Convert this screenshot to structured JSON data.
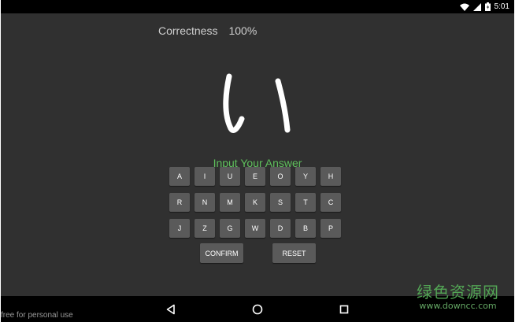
{
  "status_bar": {
    "time": "5:01",
    "icons": [
      "wifi-icon",
      "signal-icon",
      "battery-icon"
    ]
  },
  "header": {
    "correctness_label": "Correctness",
    "correctness_value": "100%"
  },
  "character": {
    "glyph": "い",
    "color": "#ffffff"
  },
  "prompt": {
    "text": "Input Your Answer",
    "color": "#5fbf5c"
  },
  "keyboard": {
    "rows": [
      [
        "A",
        "I",
        "U",
        "E",
        "O",
        "Y",
        "H"
      ],
      [
        "R",
        "N",
        "M",
        "K",
        "S",
        "T",
        "C"
      ],
      [
        "J",
        "Z",
        "G",
        "W",
        "D",
        "B",
        "P"
      ]
    ]
  },
  "actions": {
    "confirm_label": "CONFIRM",
    "reset_label": "RESET"
  },
  "nav": {
    "icons": [
      "back-icon",
      "home-icon",
      "recent-apps-icon"
    ]
  },
  "watermark": {
    "bottom_text": "free for personal use",
    "logo_text": "绿色资源网",
    "logo_url": "www.downcc.com",
    "logo_color": "#57b35a"
  }
}
